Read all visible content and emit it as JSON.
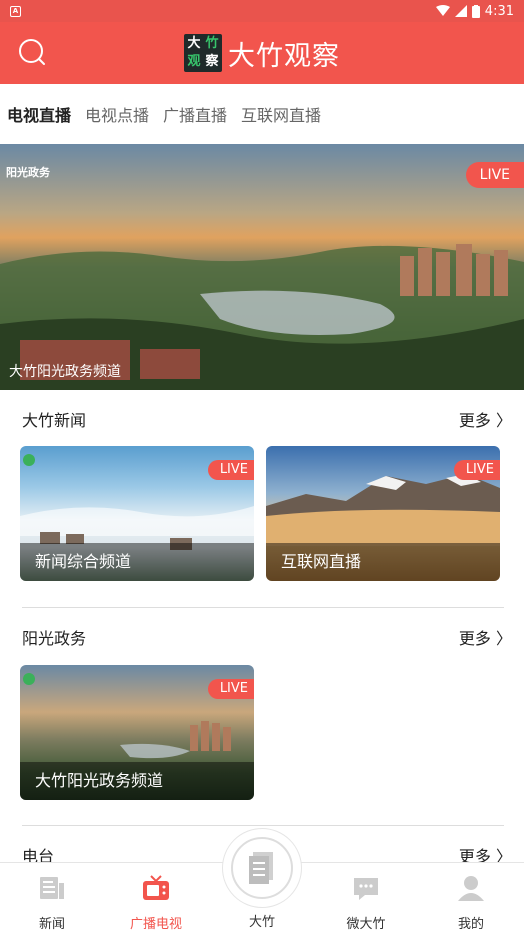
{
  "status_bar": {
    "time": "4:31"
  },
  "header": {
    "logo_chars": [
      "大",
      "竹",
      "观",
      "察"
    ],
    "title": "大竹观察"
  },
  "tabs": [
    {
      "label": "电视直播",
      "active": true
    },
    {
      "label": "电视点播",
      "active": false
    },
    {
      "label": "广播直播",
      "active": false
    },
    {
      "label": "互联网直播",
      "active": false
    }
  ],
  "hero": {
    "corner_label": "阳光政务",
    "live": "LIVE",
    "caption": "大竹阳光政务频道"
  },
  "sections": [
    {
      "title": "大竹新闻",
      "more": "更多 〉",
      "cards": [
        {
          "caption": "新闻综合频道",
          "live": "LIVE"
        },
        {
          "caption": "互联网直播",
          "live": "LIVE"
        }
      ]
    },
    {
      "title": "阳光政务",
      "more": "更多 〉",
      "cards": [
        {
          "caption": "大竹阳光政务频道",
          "live": "LIVE"
        }
      ]
    },
    {
      "title": "电台",
      "more": "更多 〉"
    }
  ],
  "bottom_nav": [
    {
      "label": "新闻",
      "icon": "news-icon",
      "active": false
    },
    {
      "label": "广播电视",
      "icon": "tv-icon",
      "active": true
    },
    {
      "label": "大竹",
      "icon": "document-icon",
      "active": false
    },
    {
      "label": "微大竹",
      "icon": "chat-icon",
      "active": false
    },
    {
      "label": "我的",
      "icon": "person-icon",
      "active": false
    }
  ],
  "colors": {
    "accent": "#f2554d",
    "status_bar": "#e9544d"
  }
}
